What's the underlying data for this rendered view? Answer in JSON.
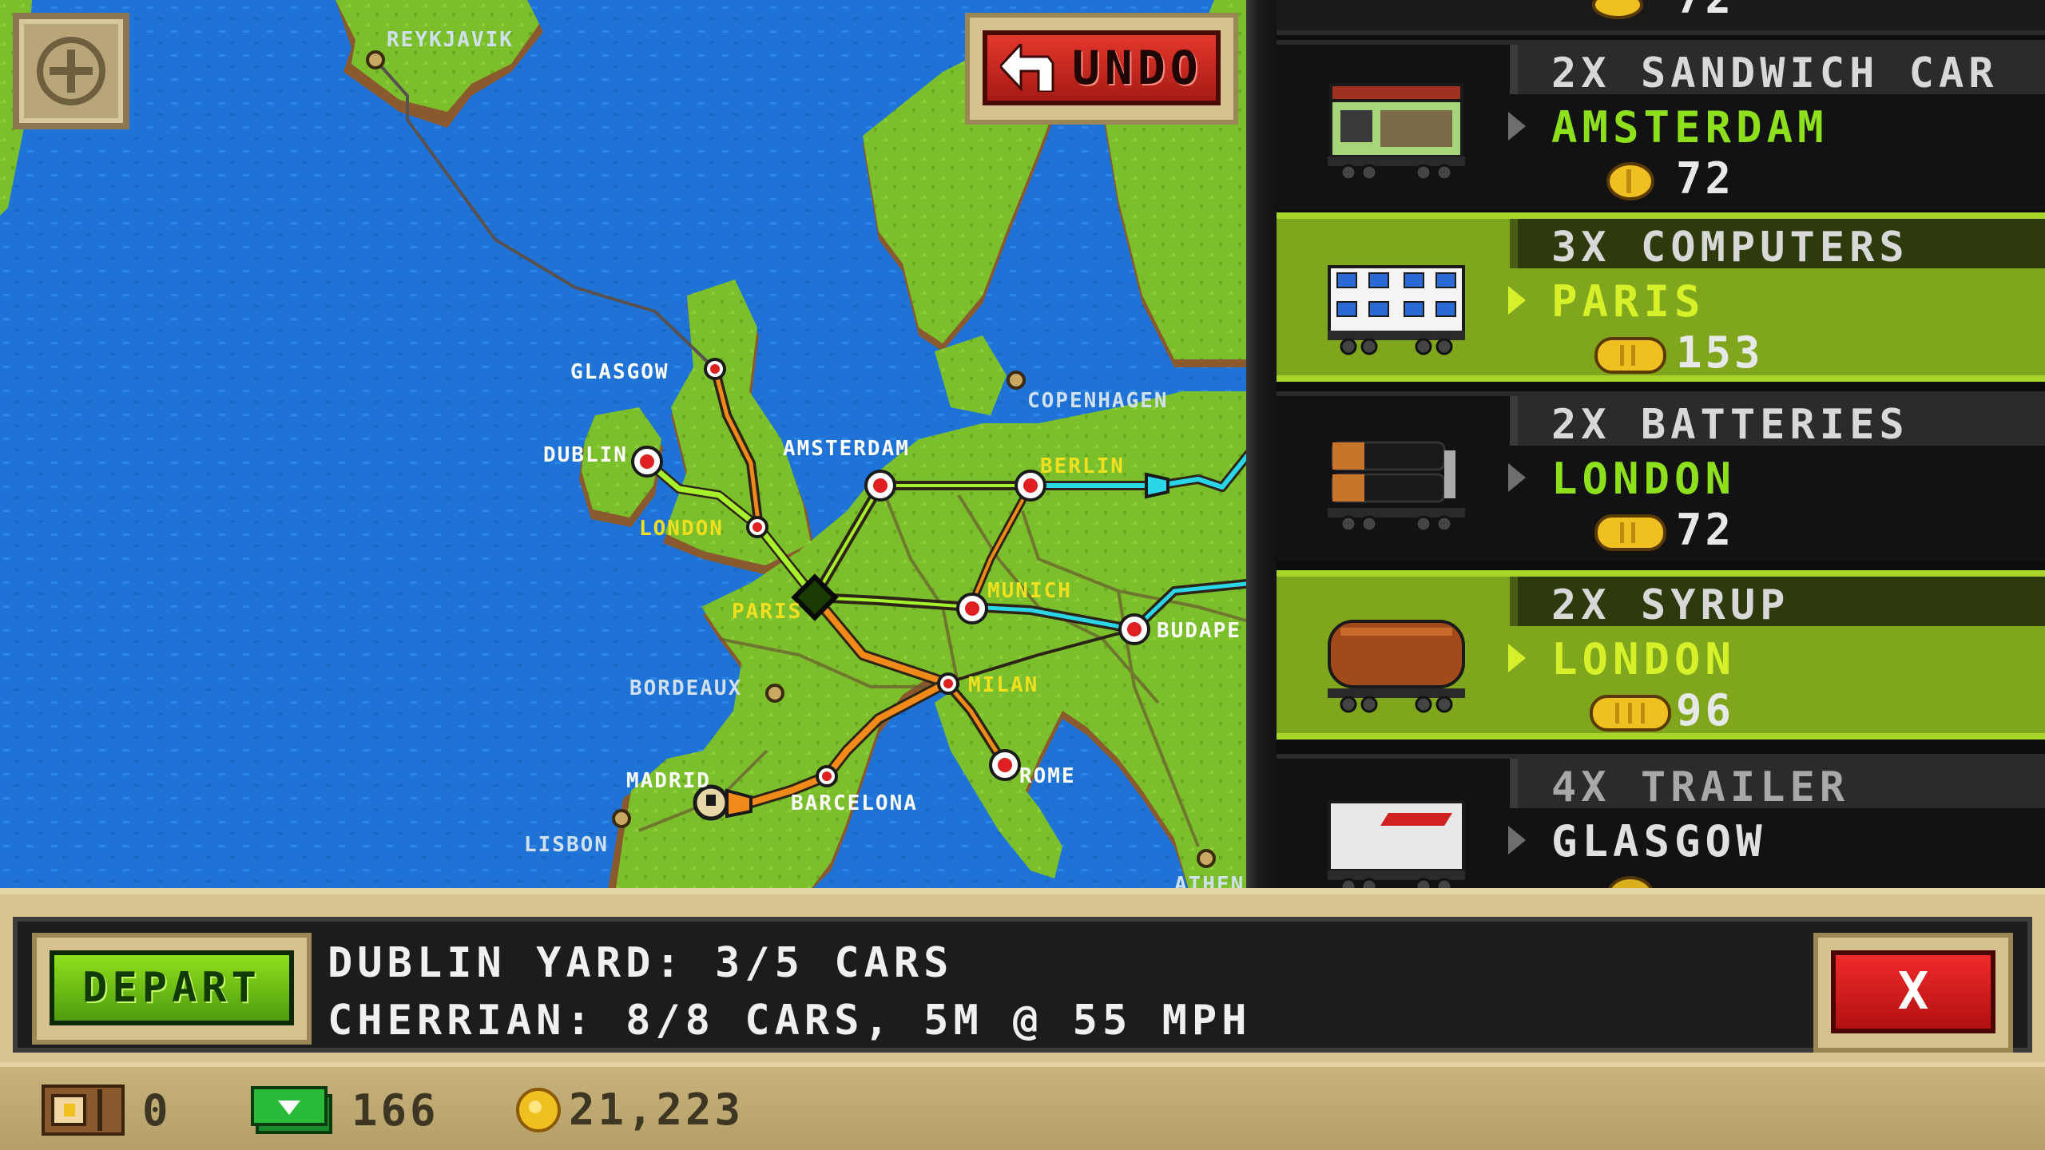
{
  "toolbar": {
    "undo_label": "UNDO"
  },
  "map": {
    "cities": {
      "reykjavik": "REYKJAVIK",
      "glasgow": "GLASGOW",
      "dublin": "DUBLIN",
      "london": "LONDON",
      "amsterdam": "AMSTERDAM",
      "berlin": "BERLIN",
      "copenhagen": "COPENHAGEN",
      "paris": "PARIS",
      "munich": "MUNICH",
      "budapest": "BUDAPE",
      "bordeaux": "BORDEAUX",
      "milan": "MILAN",
      "rome": "ROME",
      "madrid": "MADRID",
      "barcelona": "BARCELONA",
      "lisbon": "LISBON",
      "athens": "ATHENS"
    }
  },
  "cargo": {
    "top_partial_value": "72",
    "items": [
      {
        "title": "2X SANDWICH CAR",
        "destination": "AMSTERDAM",
        "value": "72",
        "state": "normal",
        "car": "sandwich-car"
      },
      {
        "title": "3X COMPUTERS",
        "destination": "PARIS",
        "value": "153",
        "state": "selected",
        "car": "computers-car"
      },
      {
        "title": "2X BATTERIES",
        "destination": "LONDON",
        "value": "72",
        "state": "normal",
        "car": "batteries-car"
      },
      {
        "title": "2X SYRUP",
        "destination": "LONDON",
        "value": "96",
        "state": "selected",
        "car": "syrup-car"
      },
      {
        "title": "4X TRAILER",
        "destination": "GLASGOW",
        "value": "",
        "state": "dim",
        "car": "trailer-car"
      }
    ]
  },
  "info": {
    "depart_label": "DEPART",
    "line1": "DUBLIN YARD: 3/5 CARS",
    "line2": "CHERRIAN: 8/8 CARS, 5M @ 55 MPH",
    "close_label": "X"
  },
  "status": {
    "crates": "0",
    "cash": "166",
    "coins": "21,223"
  },
  "colors": {
    "sea": "#1f73d6",
    "land": "#7cbf2c",
    "cargo_selected": "#7fa61c",
    "destination_text": "#8fe01c",
    "route_orange": "#f28a1a",
    "route_cyan": "#2ad6e8"
  }
}
